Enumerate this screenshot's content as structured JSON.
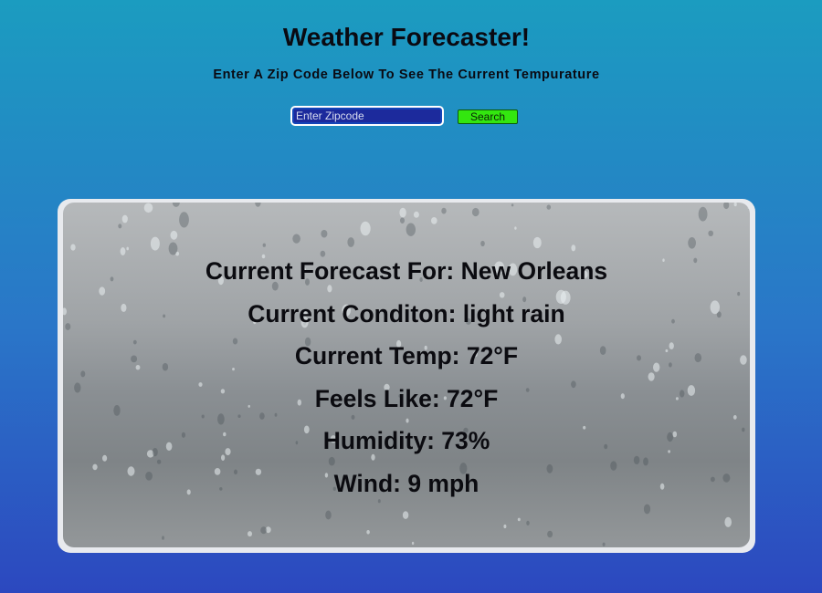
{
  "header": {
    "title": "Weather Forecaster!",
    "subtitle": "Enter A Zip Code Below To See The Current Tempurature"
  },
  "search": {
    "placeholder": "Enter Zipcode",
    "value": "",
    "button_label": "Search"
  },
  "forecast": {
    "location": "Current Forecast For: New Orleans",
    "condition": "Current Conditon: light rain",
    "temp": "Current Temp: 72°F",
    "feels_like": "Feels Like: 72°F",
    "humidity": "Humidity: 73%",
    "wind": "Wind: 9 mph"
  },
  "colors": {
    "search_button": "#33e60f",
    "background_top": "#1b9cc0",
    "background_bottom": "#2c48bf"
  },
  "card_background": "rain-on-window"
}
